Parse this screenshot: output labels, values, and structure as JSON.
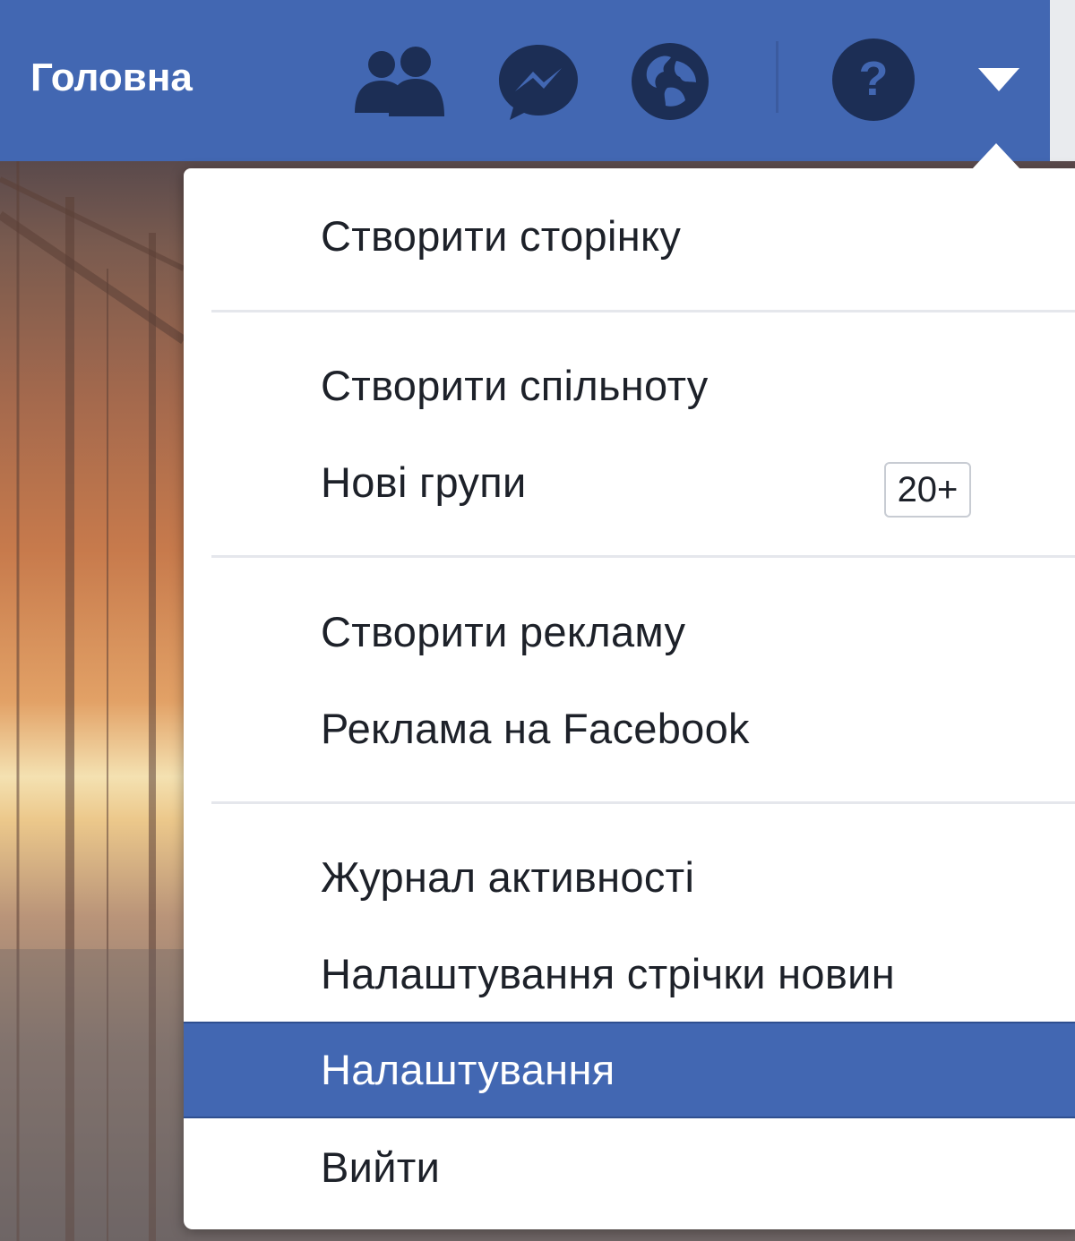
{
  "topbar": {
    "home_label": "Головна",
    "icons": [
      "friends-icon",
      "messenger-icon",
      "globe-notifications-icon",
      "help-icon",
      "account-menu-caret-icon"
    ],
    "background_color": "#4267b2",
    "icon_color": "#1c2e55"
  },
  "menu": {
    "items": [
      {
        "label": "Створити сторінку"
      },
      {
        "label": "Створити спільноту"
      },
      {
        "label": "Нові групи",
        "badge": "20+"
      },
      {
        "label": "Створити рекламу"
      },
      {
        "label": "Реклама на Facebook"
      },
      {
        "label": "Журнал активності"
      },
      {
        "label": "Налаштування стрічки новин"
      },
      {
        "label": "Налаштування",
        "highlighted": true
      },
      {
        "label": "Вийти"
      }
    ],
    "highlight_color": "#4267b2"
  }
}
